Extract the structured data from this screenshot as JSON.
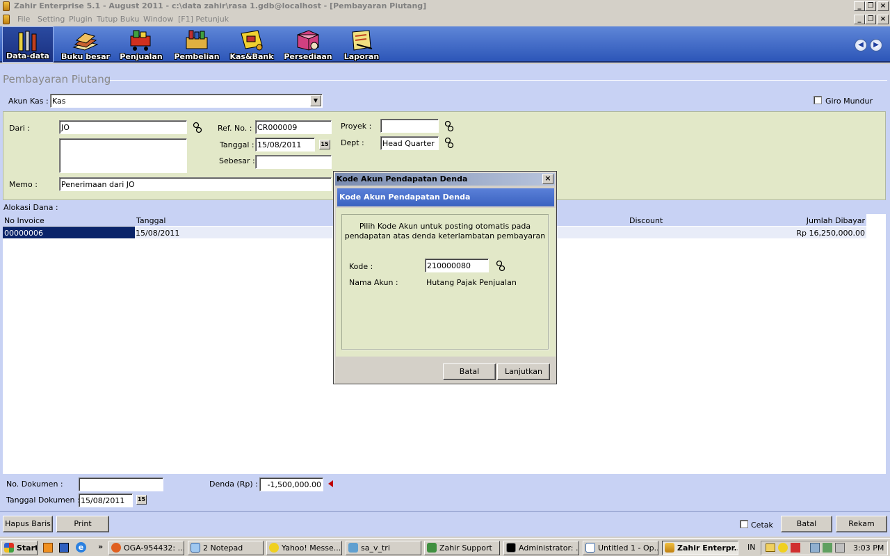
{
  "window": {
    "title": "Zahir Enterprise 5.1 - August 2011 - c:\\data zahir\\rasa 1.gdb@localhost - [Pembayaran Piutang]"
  },
  "menu": [
    "File",
    "Setting",
    "Plugin",
    "Tutup Buku",
    "Window",
    "[F1] Petunjuk"
  ],
  "toolbar": {
    "items": [
      "Data-data",
      "Buku besar",
      "Penjualan",
      "Pembelian",
      "Kas&Bank",
      "Persediaan",
      "Laporan"
    ]
  },
  "page": {
    "title": "Pembayaran Piutang",
    "akun_kas_label": "Akun Kas :",
    "akun_kas_value": "Kas",
    "giro_label": "Giro Mundur",
    "dari_label": "Dari :",
    "dari_value": "JO",
    "memo_label": "Memo :",
    "memo_value": "Penerimaan dari JO",
    "ref_label": "Ref. No. :",
    "ref_value": "CR000009",
    "tanggal_label": "Tanggal :",
    "tanggal_value": "15/08/2011",
    "sebesar_label": "Sebesar :",
    "proyek_label": "Proyek :",
    "dept_label": "Dept :",
    "dept_value": "Head Quarter",
    "calendar_icon_text": "15",
    "alokasi_label": "Alokasi Dana :"
  },
  "grid": {
    "headers": [
      "No Invoice",
      "Tanggal",
      "Discount",
      "Jumlah Dibayar"
    ],
    "rows": [
      {
        "no_invoice": "00000006",
        "tanggal": "15/08/2011",
        "discount": "",
        "jumlah": "Rp 16,250,000.00"
      }
    ]
  },
  "footer": {
    "no_dok_label": "No. Dokumen :",
    "tgl_dok_label": "Tanggal Dokumen :",
    "tgl_dok_value": "15/08/2011",
    "denda_label": "Denda (Rp) :",
    "denda_value": "-1,500,000.00",
    "hapus_label": "Hapus Baris",
    "print_label": "Print",
    "cetak_label": "Cetak",
    "batal_label": "Batal",
    "rekam_label": "Rekam"
  },
  "dialog": {
    "title": "Kode Akun Pendapatan Denda",
    "header": "Kode Akun Pendapatan Denda",
    "desc1": "Pilih Kode Akun untuk posting otomatis pada",
    "desc2": "pendapatan atas denda keterlambatan pembayaran",
    "kode_label": "Kode :",
    "kode_value": "210000080",
    "nama_label": "Nama Akun :",
    "nama_value": "Hutang Pajak Penjualan",
    "batal_label": "Batal",
    "lanjut_label": "Lanjutkan"
  },
  "taskbar": {
    "start": "Start",
    "items": [
      "OGA-954432: ...",
      "2 Notepad",
      "Yahoo! Messe...",
      "sa_v_tri",
      "Zahir Support",
      "Administrator: ...",
      "Untitled 1 - Op...",
      "Zahir Enterpr..."
    ],
    "lang": "IN",
    "time": "3:03 PM"
  },
  "colors": {
    "toolbar": "#2d56b8",
    "main_bg": "#c8d2f4",
    "form_bg": "#e2e8c8",
    "selected_cell": "#0a246a"
  }
}
